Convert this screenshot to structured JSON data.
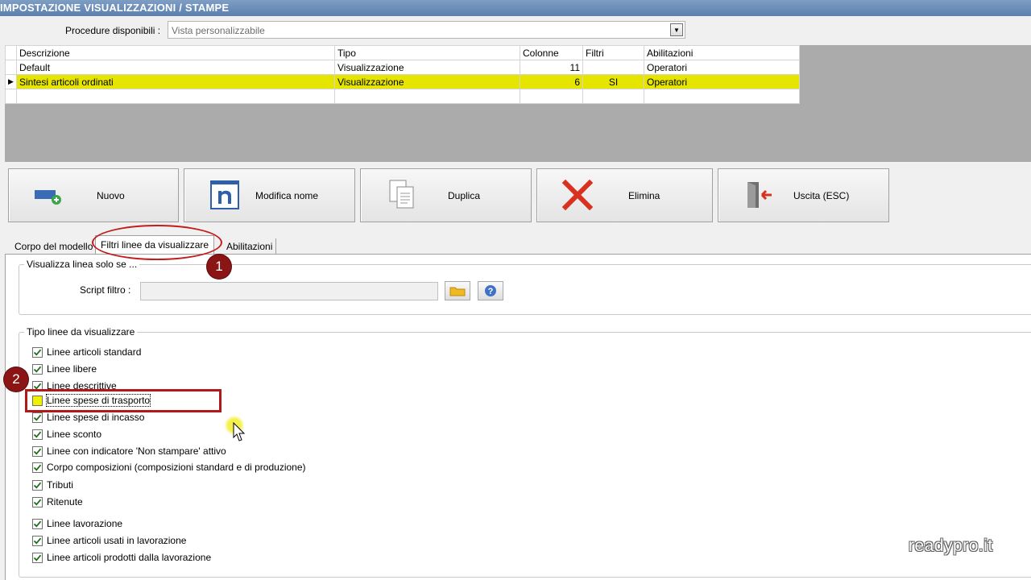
{
  "window": {
    "title": "IMPOSTAZIONE VISUALIZZAZIONI / STAMPE"
  },
  "procedures": {
    "label": "Procedure disponibili :",
    "value": "Vista personalizzabile"
  },
  "grid": {
    "headers": [
      "Descrizione",
      "Tipo",
      "Colonne",
      "Filtri",
      "Abilitazioni"
    ],
    "rows": [
      {
        "descrizione": "Default",
        "tipo": "Visualizzazione",
        "colonne": "11",
        "filtri": "",
        "abilitazioni": "Operatori"
      },
      {
        "descrizione": "Sintesi articoli ordinati",
        "tipo": "Visualizzazione",
        "colonne": "6",
        "filtri": "SI",
        "abilitazioni": "Operatori"
      }
    ],
    "selected_row_color": "#e5e500"
  },
  "toolbar": {
    "nuovo": "Nuovo",
    "modifica_nome": "Modifica nome",
    "duplica": "Duplica",
    "elimina": "Elimina",
    "uscita": "Uscita (ESC)"
  },
  "tabs": [
    "Corpo del modello",
    "Filtri linee da visualizzare",
    "Abilitazioni"
  ],
  "filter_group": {
    "legend": "Visualizza linea solo se ...",
    "script_label": "Script filtro :",
    "script_value": ""
  },
  "lines_group": {
    "legend": "Tipo linee da visualizzare",
    "items": [
      {
        "label": "Linee articoli standard",
        "checked": true
      },
      {
        "label": "Linee libere",
        "checked": true
      },
      {
        "label": "Linee descrittive",
        "checked": true
      },
      {
        "label": "Linee spese di trasporto",
        "checked": false
      },
      {
        "label": "Linee spese di incasso",
        "checked": true
      },
      {
        "label": "Linee sconto",
        "checked": true
      },
      {
        "label": "Linee con indicatore 'Non stampare' attivo",
        "checked": true
      },
      {
        "label": "Corpo composizioni (composizioni standard e di produzione)",
        "checked": true
      },
      {
        "label": "Tributi",
        "checked": true
      },
      {
        "label": "Ritenute",
        "checked": true
      },
      {
        "label": "Linee lavorazione",
        "checked": true
      },
      {
        "label": "Linee articoli usati in lavorazione",
        "checked": true
      },
      {
        "label": "Linee articoli prodotti dalla lavorazione",
        "checked": true
      }
    ]
  },
  "annotations": {
    "marker1": "1",
    "marker2": "2",
    "accent": "#b11919"
  },
  "watermark": "readypro.it"
}
